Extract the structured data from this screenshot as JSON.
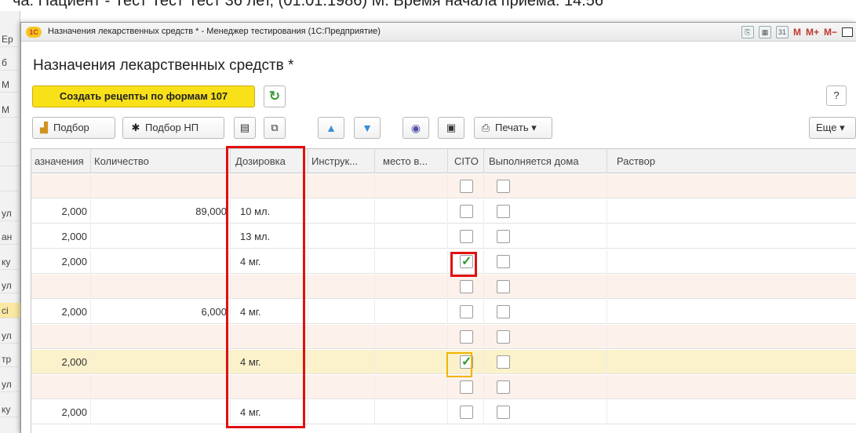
{
  "background": {
    "title_fragment": "ча: Пациент - Тест Тест Тест 36 лет, (01.01.1986) М. Время начала приема: 14:56",
    "left_column_fragments": [
      "Ер",
      "б",
      "М",
      "М",
      "",
      "",
      "",
      "ул",
      "ан",
      "ку",
      "ул",
      "сі",
      "ул",
      "тр",
      "ул",
      "ку"
    ]
  },
  "window": {
    "title": "Назначения лекарственных средств * - Менеджер тестирования (1С:Предприятие)",
    "logo": "1С",
    "toolbar": {
      "calc_icon": "calculator-icon",
      "calendar_label": "31",
      "m": "M",
      "m_plus": "M+",
      "m_minus": "M−"
    }
  },
  "form": {
    "title": "Назначения лекарственных средств *",
    "create_button": "Создать рецепты по формам 107",
    "refresh_icon": "refresh-icon",
    "help_label": "?"
  },
  "commands": {
    "pick_label": "Подбор",
    "pick_np_label": "Подбор НП",
    "print_label": "Печать",
    "more_label": "Еще"
  },
  "table": {
    "columns": [
      "азначения",
      "Количество",
      "Дозировка",
      "Инструк...",
      "место в...",
      "CITO",
      "Выполняется дома",
      "Раствор"
    ],
    "rows": [
      {
        "kind": "group",
        "qty1": "",
        "qty2": "",
        "dose": "",
        "cito": false,
        "home": false
      },
      {
        "kind": "item",
        "qty1": "2,000",
        "qty2": "89,000",
        "dose": "10 мл.",
        "cito": false,
        "home": false
      },
      {
        "kind": "item",
        "qty1": "2,000",
        "qty2": "",
        "dose": "13 мл.",
        "cito": false,
        "home": false
      },
      {
        "kind": "item",
        "qty1": "2,000",
        "qty2": "",
        "dose": "4 мг.",
        "cito": true,
        "home": false
      },
      {
        "kind": "group",
        "qty1": "",
        "qty2": "",
        "dose": "",
        "cito": false,
        "home": false
      },
      {
        "kind": "item",
        "qty1": "2,000",
        "qty2": "6,000",
        "dose": "4 мг.",
        "cito": false,
        "home": false
      },
      {
        "kind": "group",
        "qty1": "",
        "qty2": "",
        "dose": "",
        "cito": false,
        "home": false
      },
      {
        "kind": "selected",
        "qty1": "2,000",
        "qty2": "",
        "dose": "4 мг.",
        "cito": true,
        "home": false
      },
      {
        "kind": "group",
        "qty1": "",
        "qty2": "",
        "dose": "",
        "cito": false,
        "home": false
      },
      {
        "kind": "item",
        "qty1": "2,000",
        "qty2": "",
        "dose": "4 мг.",
        "cito": false,
        "home": false
      }
    ]
  },
  "colors": {
    "accent_yellow": "#f9e11a",
    "annotation_red": "#e01010",
    "selection_row": "#fbf2cc",
    "group_row": "#fdf1ec",
    "check_green": "#2e9a2e"
  }
}
